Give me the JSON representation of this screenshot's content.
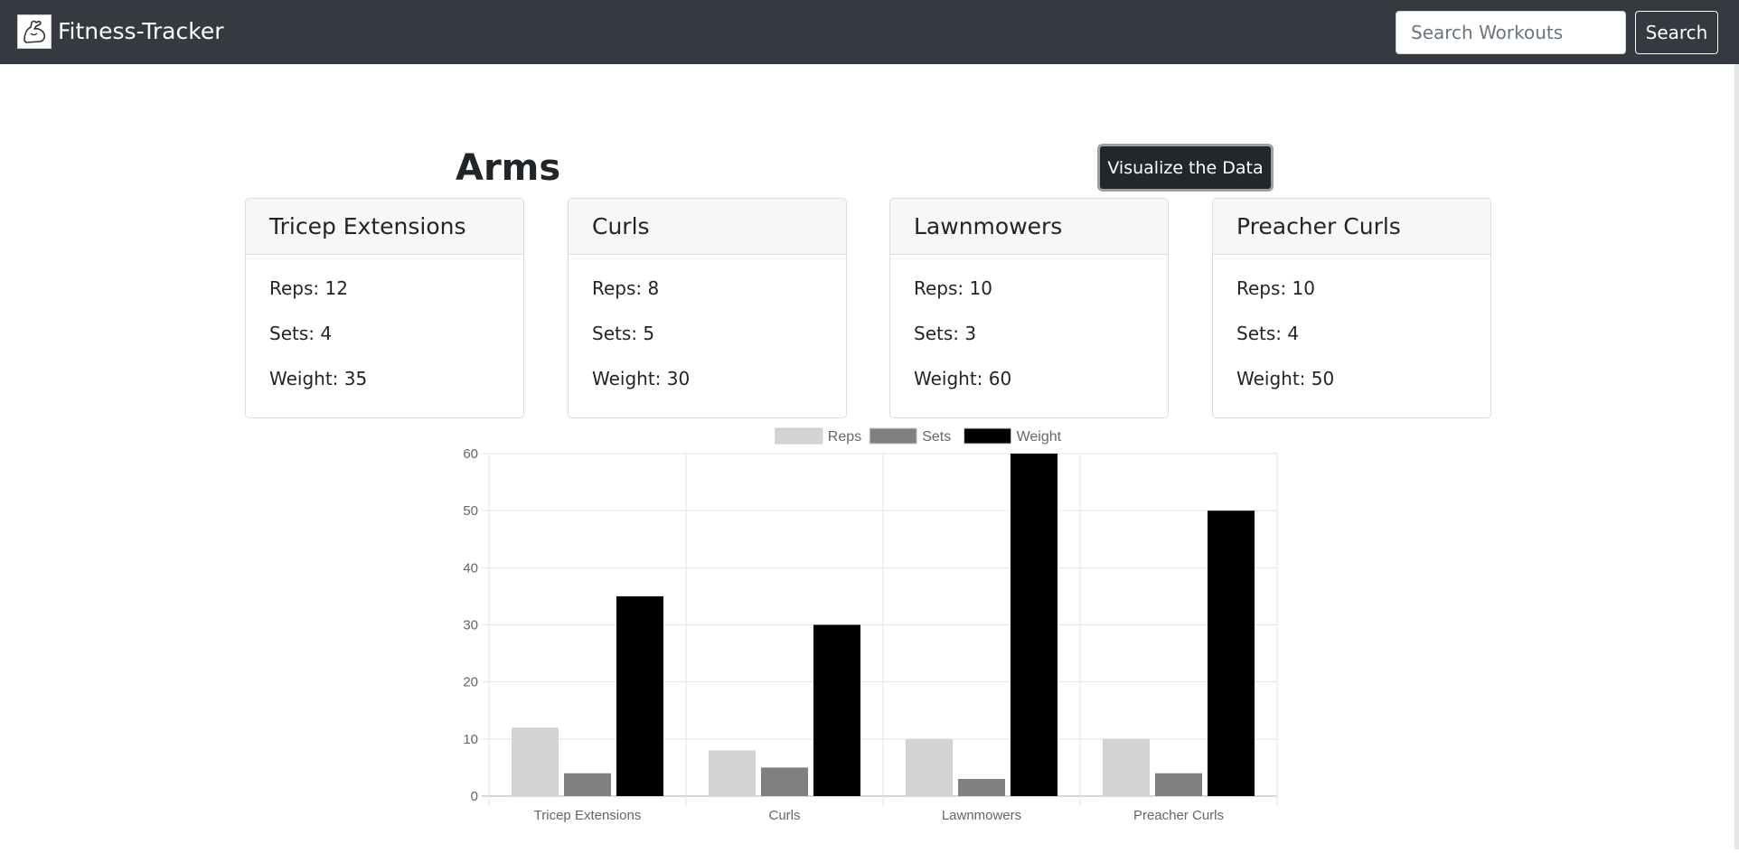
{
  "navbar": {
    "brand": "Fitness-Tracker",
    "logo_icon": "flexed-arm-icon",
    "search": {
      "placeholder": "Search Workouts",
      "value": ""
    },
    "search_button": "Search",
    "background": "#343a40"
  },
  "page": {
    "title": "Arms",
    "visualize_button": "Visualize the Data"
  },
  "exercises": [
    {
      "name": "Tricep Extensions",
      "reps": "Reps: 12",
      "sets": "Sets: 4",
      "weight": "Weight: 35"
    },
    {
      "name": "Curls",
      "reps": "Reps: 8",
      "sets": "Sets: 5",
      "weight": "Weight: 30"
    },
    {
      "name": "Lawnmowers",
      "reps": "Reps: 10",
      "sets": "Sets: 3",
      "weight": "Weight: 60"
    },
    {
      "name": "Preacher Curls",
      "reps": "Reps: 10",
      "sets": "Sets: 4",
      "weight": "Weight: 50"
    }
  ],
  "chart_data": {
    "type": "bar",
    "categories": [
      "Tricep Extensions",
      "Curls",
      "Lawnmowers",
      "Preacher Curls"
    ],
    "series": [
      {
        "name": "Reps",
        "values": [
          12,
          8,
          10,
          10
        ],
        "color": "#d3d3d3"
      },
      {
        "name": "Sets",
        "values": [
          4,
          5,
          3,
          4
        ],
        "color": "#808080"
      },
      {
        "name": "Weight",
        "values": [
          35,
          30,
          60,
          50
        ],
        "color": "#000000"
      }
    ],
    "yticks": [
      0,
      10,
      20,
      30,
      40,
      50,
      60
    ],
    "ylim": [
      0,
      60
    ],
    "legend": "top",
    "grid": true
  }
}
